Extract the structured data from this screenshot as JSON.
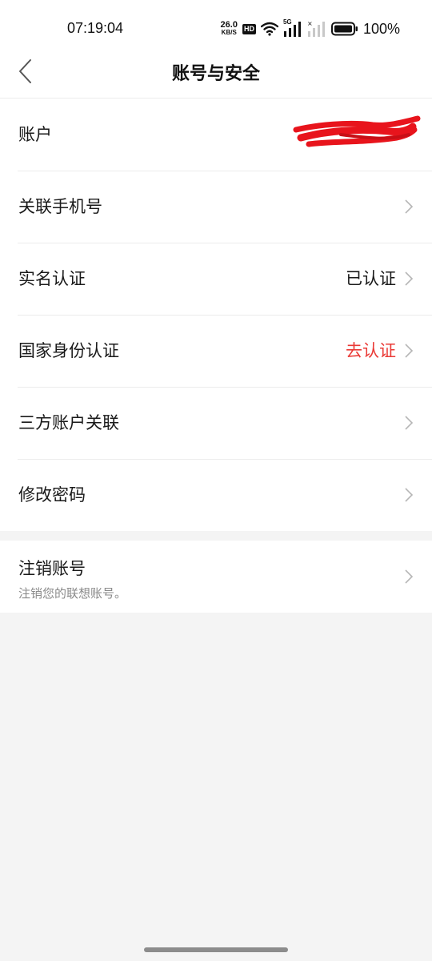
{
  "status_bar": {
    "time": "07:19:04",
    "net_speed_value": "26.0",
    "net_speed_unit": "KB/S",
    "hd_label": "HD",
    "signal_label": "5G",
    "battery_percent": "100%"
  },
  "header": {
    "title": "账号与安全"
  },
  "settings": {
    "account_label": "账户",
    "phone_label": "关联手机号",
    "realname_label": "实名认证",
    "realname_value": "已认证",
    "national_id_label": "国家身份认证",
    "national_id_value": "去认证",
    "third_party_label": "三方账户关联",
    "change_password_label": "修改密码"
  },
  "cancel": {
    "title": "注销账号",
    "subtitle": "注销您的联想账号。"
  },
  "colors": {
    "accent_red": "#ea3a36",
    "background": "#f4f4f4",
    "card": "#ffffff"
  }
}
